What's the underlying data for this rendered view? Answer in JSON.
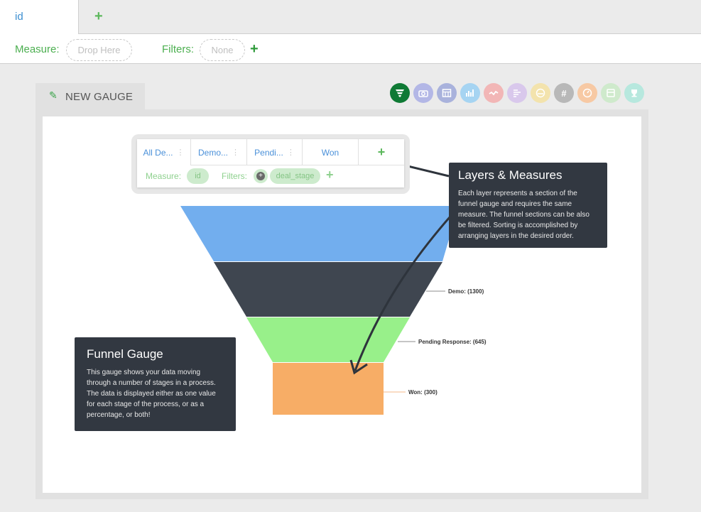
{
  "tabs": {
    "active_label": "id",
    "add_icon": "plus-icon"
  },
  "measure_bar": {
    "measure_label": "Measure:",
    "measure_placeholder": "Drop Here",
    "filters_label": "Filters:",
    "filters_value": "None"
  },
  "gauge": {
    "title": "NEW GAUGE",
    "types": [
      {
        "name": "funnel",
        "color": "#0f7a35",
        "active": true
      },
      {
        "name": "camera",
        "color": "#b3b7e6"
      },
      {
        "name": "table",
        "color": "#a9b2dc"
      },
      {
        "name": "bar",
        "color": "#a6d4f2"
      },
      {
        "name": "trend",
        "color": "#f2b6b6"
      },
      {
        "name": "list",
        "color": "#d9c8ec"
      },
      {
        "name": "dial",
        "color": "#f3e3ad"
      },
      {
        "name": "number",
        "color": "#b8b8b8"
      },
      {
        "name": "speedometer",
        "color": "#f7c9a4"
      },
      {
        "name": "card",
        "color": "#cfeacc"
      },
      {
        "name": "trophy",
        "color": "#b7e8de"
      }
    ]
  },
  "layers": {
    "tabs": [
      "All De...",
      "Demo...",
      "Pendi...",
      "Won"
    ],
    "measure_label": "Measure:",
    "measure_value": "id",
    "filters_label": "Filters:",
    "filter_value": "deal_stage"
  },
  "callout_layers": {
    "title": "Layers & Measures",
    "text": "Each layer represents a section of the funnel gauge and requires the same measure. The funnel sections can be also be filtered. Sorting is accomplished by arranging layers in the desired order."
  },
  "callout_funnel": {
    "title": "Funnel Gauge",
    "text": "This gauge shows your data moving through a number of stages in a process. The data is displayed either as one value for each stage of the process, or as a percentage, or both!"
  },
  "funnel": {
    "sections": [
      {
        "label": "",
        "color": "#72aeee"
      },
      {
        "label": "Demo: (1300)",
        "color": "#3f4650"
      },
      {
        "label": "Pending Response: (645)",
        "color": "#98f08a"
      },
      {
        "label": "Won: (300)",
        "color": "#f7ad66"
      }
    ]
  }
}
